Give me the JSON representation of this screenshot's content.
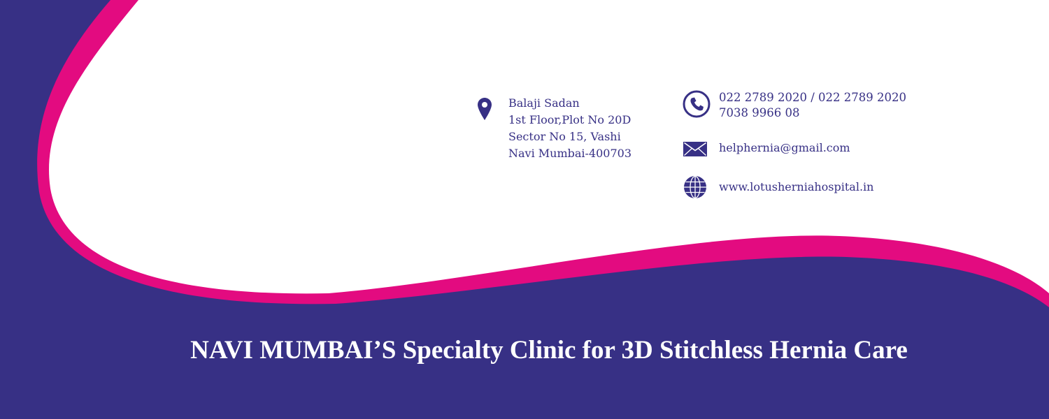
{
  "colors": {
    "navy": "#373085",
    "magenta": "#e30b80",
    "white": "#ffffff"
  },
  "contact": {
    "address": {
      "icon": "location-pin-icon",
      "lines": [
        "Balaji Sadan",
        "1st Floor,Plot No 20D",
        "Sector No 15, Vashi",
        "Navi Mumbai-400703"
      ]
    },
    "phone": {
      "icon": "phone-icon",
      "lines": [
        "022 2789 2020 / 022 2789 2020",
        "7038 9966 08"
      ]
    },
    "email": {
      "icon": "envelope-icon",
      "value": "helphernia@gmail.com"
    },
    "website": {
      "icon": "globe-icon",
      "value": "www.lotusherniahospital.in"
    }
  },
  "tagline": "NAVI MUMBAI’S Specialty Clinic for 3D Stitchless Hernia Care"
}
